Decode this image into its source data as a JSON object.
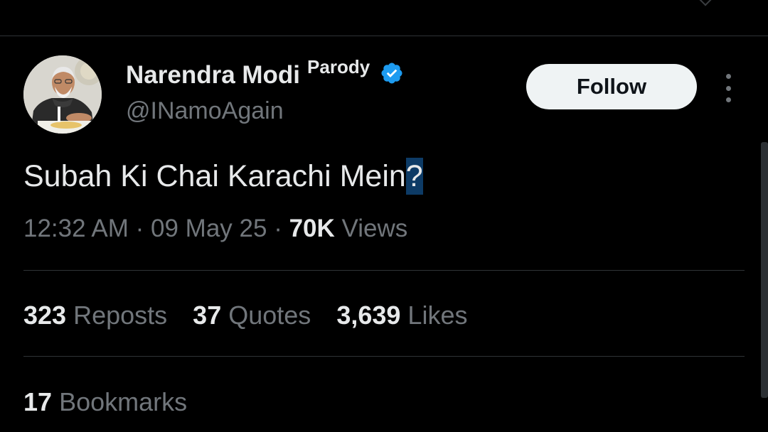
{
  "author": {
    "display_name": "Narendra Modi",
    "label": "Parody",
    "handle": "@INamoAgain",
    "verified_color": "#1d9bf0"
  },
  "actions": {
    "follow_label": "Follow",
    "more_icon": "more-vertical-icon"
  },
  "tweet": {
    "text_main": "Subah Ki Chai Karachi Mein",
    "text_highlighted": "?"
  },
  "meta": {
    "time": "12:32 AM",
    "separator": "·",
    "date": "09 May 25",
    "views_count": "70K",
    "views_label": "Views"
  },
  "stats": {
    "reposts": {
      "count": "323",
      "label": "Reposts"
    },
    "quotes": {
      "count": "37",
      "label": "Quotes"
    },
    "likes": {
      "count": "3,639",
      "label": "Likes"
    },
    "bookmarks": {
      "count": "17",
      "label": "Bookmarks"
    }
  },
  "colors": {
    "background": "#000000",
    "text_primary": "#e7e9ea",
    "text_secondary": "#71767b",
    "divider": "#2f3336",
    "selection_highlight": "#0d3b66"
  }
}
